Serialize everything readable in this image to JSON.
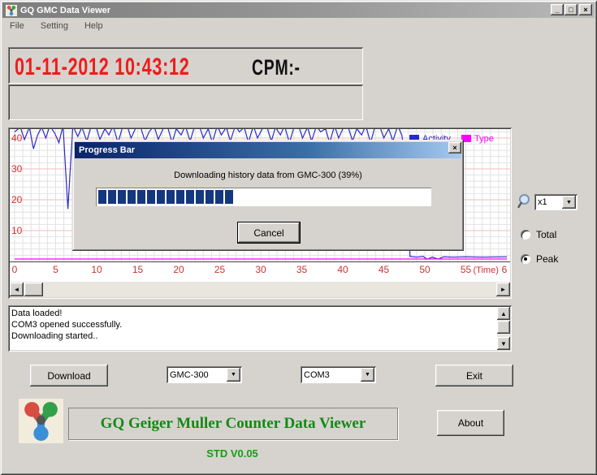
{
  "window": {
    "title": "GQ GMC Data Viewer"
  },
  "icons": {
    "minimize_glyph": "_",
    "maximize_glyph": "□",
    "close_glyph": "×",
    "arrow_left": "◄",
    "arrow_right": "►",
    "arrow_up": "▲",
    "arrow_down": "▼",
    "combo_arrow": "▼"
  },
  "menu": [
    "File",
    "Setting",
    "Help"
  ],
  "display": {
    "datetime": "01-11-2012 10:43:12",
    "cpm": "CPM:-"
  },
  "chart_data": {
    "type": "line",
    "title": "",
    "xlabel": "(Time)",
    "x_ticks": [
      0,
      5,
      10,
      15,
      20,
      25,
      30,
      35,
      40,
      45,
      50,
      55
    ],
    "x_axis_suffix": "(Time)",
    "x_edge_label": "6",
    "y_ticks": [
      10,
      20,
      30,
      40
    ],
    "xlim": [
      0,
      60
    ],
    "ylim": [
      0,
      42.5
    ],
    "grid": {
      "on": true,
      "minor": "#e2e2e2",
      "major_h": "#f2bcbc"
    },
    "tick_color": "#cc3333",
    "legend_position": "top-right",
    "series": [
      {
        "name": "Activity",
        "color": "#2a2ac8",
        "points": [
          [
            0,
            42
          ],
          [
            0.7,
            43.5
          ],
          [
            1.2,
            39.5
          ],
          [
            1.8,
            43.5
          ],
          [
            2.3,
            36.5
          ],
          [
            2.8,
            41
          ],
          [
            3.3,
            43.5
          ],
          [
            3.8,
            40
          ],
          [
            4.3,
            44
          ],
          [
            4.9,
            41.5
          ],
          [
            5.4,
            38.5
          ],
          [
            5.9,
            44
          ],
          [
            6.5,
            17
          ],
          [
            7.1,
            44
          ],
          [
            7.7,
            40.5
          ],
          [
            8.2,
            43.5
          ],
          [
            8.8,
            39
          ],
          [
            9.3,
            43.5
          ],
          [
            9.9,
            44
          ],
          [
            10.4,
            39.5
          ],
          [
            11,
            43
          ],
          [
            11.5,
            41
          ],
          [
            12,
            44
          ],
          [
            12.6,
            38.5
          ],
          [
            13.1,
            43
          ],
          [
            13.7,
            44
          ],
          [
            14.2,
            40
          ],
          [
            14.8,
            43.5
          ],
          [
            15.3,
            44
          ],
          [
            15.9,
            39
          ],
          [
            16.4,
            42
          ],
          [
            17,
            44
          ],
          [
            17.5,
            39.5
          ],
          [
            18.1,
            43
          ],
          [
            18.6,
            44
          ],
          [
            19.2,
            38.5
          ],
          [
            19.7,
            43
          ],
          [
            20.3,
            41
          ],
          [
            20.8,
            44
          ],
          [
            21.4,
            39
          ],
          [
            21.9,
            43.5
          ],
          [
            22.5,
            44
          ],
          [
            23,
            40
          ],
          [
            23.6,
            43
          ],
          [
            24.1,
            38.5
          ],
          [
            24.7,
            44
          ],
          [
            25.2,
            41
          ],
          [
            25.8,
            43.5
          ],
          [
            26.3,
            39
          ],
          [
            26.9,
            44
          ],
          [
            27.4,
            42
          ],
          [
            28,
            43.5
          ],
          [
            28.5,
            38.5
          ],
          [
            29.1,
            44
          ],
          [
            29.6,
            40
          ],
          [
            30.2,
            43
          ],
          [
            30.7,
            44
          ],
          [
            31.3,
            39
          ],
          [
            31.8,
            43.5
          ],
          [
            32.4,
            41
          ],
          [
            32.9,
            44
          ],
          [
            33.5,
            38.5
          ],
          [
            34,
            43
          ],
          [
            34.6,
            44
          ],
          [
            35.1,
            40
          ],
          [
            35.7,
            43.5
          ],
          [
            36.2,
            39
          ],
          [
            36.8,
            44
          ],
          [
            37.3,
            42
          ],
          [
            37.9,
            43
          ],
          [
            38.4,
            38.5
          ],
          [
            39,
            44
          ],
          [
            39.5,
            40
          ],
          [
            40.1,
            43.5
          ],
          [
            40.6,
            44
          ],
          [
            41.2,
            39
          ],
          [
            41.7,
            43
          ],
          [
            42.3,
            41
          ],
          [
            42.8,
            44
          ],
          [
            43.4,
            38.5
          ],
          [
            43.9,
            43.5
          ],
          [
            44.5,
            44
          ],
          [
            45,
            40
          ],
          [
            45.6,
            43
          ],
          [
            46.1,
            39
          ],
          [
            46.7,
            44
          ],
          [
            47.2,
            41
          ],
          [
            47.8,
            30
          ],
          [
            48.2,
            1.6
          ],
          [
            49,
            1.4
          ],
          [
            49.8,
            1.6
          ],
          [
            50.3,
            0.7
          ],
          [
            50.9,
            1.4
          ],
          [
            51.6,
            0.8
          ],
          [
            52.3,
            1.5
          ],
          [
            53.5,
            1.4
          ],
          [
            55,
            1.5
          ],
          [
            57,
            1.4
          ],
          [
            60,
            1.5
          ]
        ]
      },
      {
        "name": "Type",
        "color": "#ff00ff",
        "points": [
          [
            0,
            0.8
          ],
          [
            60,
            0.8
          ]
        ]
      }
    ]
  },
  "zoom_control": {
    "value": "x1"
  },
  "mode": {
    "total_label": "Total",
    "peak_label": "Peak",
    "selected": "Peak"
  },
  "dialog": {
    "title": "Progress Bar",
    "message": "Downloading history data from GMC-300 (39%)",
    "progress_percent": 39,
    "progress_color": "#14387e",
    "cancel_label": "Cancel"
  },
  "log": {
    "lines": [
      "Data loaded!",
      "COM3 opened successfully.",
      "Downloading started.."
    ]
  },
  "controls": {
    "download_label": "Download",
    "device_value": "GMC-300",
    "port_value": "COM3",
    "exit_label": "Exit",
    "about_label": "About"
  },
  "branding": {
    "title": "GQ Geiger Muller Counter Data Viewer",
    "version": "STD V0.05",
    "title_color": "#148a14"
  }
}
